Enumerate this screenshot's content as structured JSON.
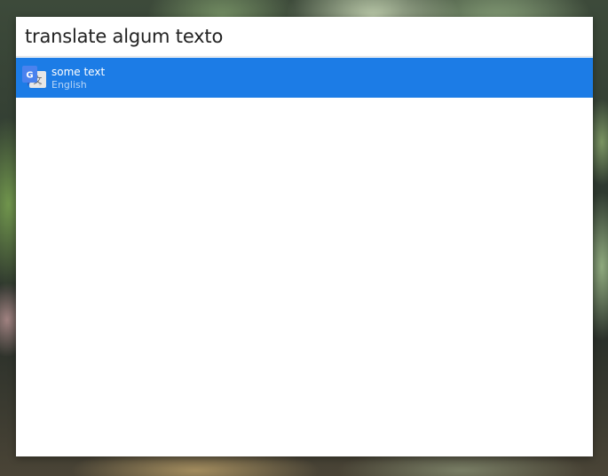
{
  "search": {
    "query": "translate algum texto",
    "placeholder": ""
  },
  "results": [
    {
      "title": "some text",
      "subtitle": "English",
      "icon": "google-translate-icon",
      "selected": true
    }
  ],
  "colors": {
    "selection": "#1c7ce6",
    "window_bg": "#ffffff",
    "query_text": "#222222"
  }
}
